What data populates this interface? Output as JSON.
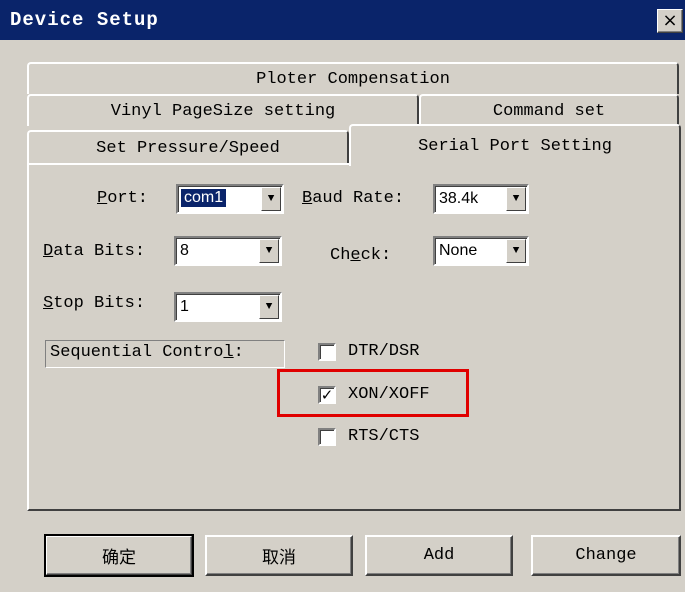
{
  "window": {
    "title": "Device Setup",
    "close_glyph": "×"
  },
  "tabs": {
    "row1": [
      "Ploter Compensation"
    ],
    "row2": [
      "Vinyl PageSize setting",
      "Command set"
    ],
    "row3": [
      "Set Pressure/Speed",
      "Serial Port Setting"
    ],
    "active": "Serial Port Setting"
  },
  "serial": {
    "port_label": "Port:",
    "port_value": "com1",
    "baud_label": "Baud Rate:",
    "baud_value": "38.4k",
    "data_bits_label": "Data Bits:",
    "data_bits_value": "8",
    "check_label": "Check:",
    "check_value": "None",
    "stop_bits_label": "Stop Bits:",
    "stop_bits_value": "1",
    "seq_label": "Sequential Control:",
    "options": [
      {
        "label": "DTR/DSR",
        "checked": false
      },
      {
        "label": "XON/XOFF",
        "checked": true
      },
      {
        "label": "RTS/CTS",
        "checked": false
      }
    ]
  },
  "buttons": {
    "ok": "确定",
    "cancel": "取消",
    "add": "Add",
    "change": "Change"
  },
  "colors": {
    "titlebar": "#0a246a",
    "face": "#d4d0c8",
    "highlight_box": "#e00000"
  }
}
